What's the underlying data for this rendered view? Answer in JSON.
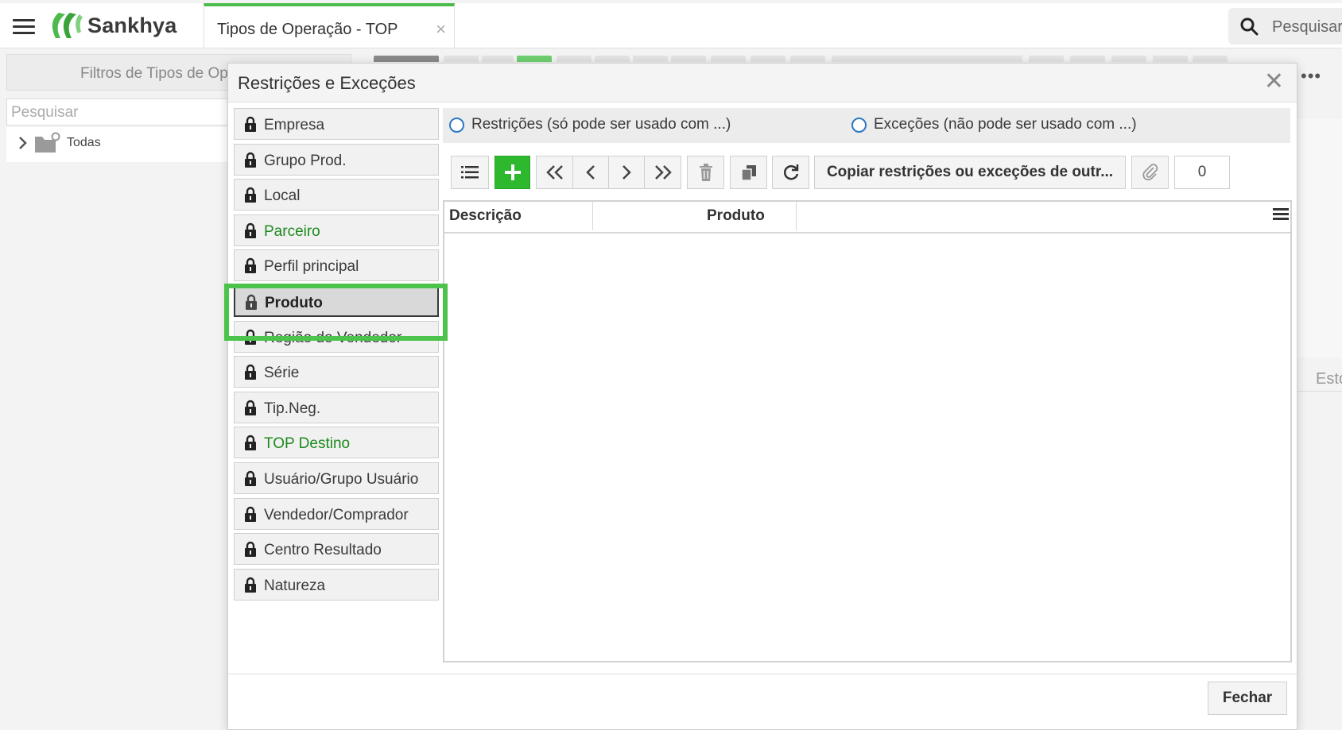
{
  "app": {
    "brand": "Sankhya"
  },
  "tab": {
    "label": "Tipos de Operação - TOP",
    "close": "×"
  },
  "search": {
    "placeholder": "Pesquisar"
  },
  "background": {
    "filters_title": "Filtros de Tipos de Op",
    "search_placeholder": "Pesquisar",
    "tree_root": "Todas",
    "more": "•••",
    "right_tab": "Esto"
  },
  "modal": {
    "title": "Restrições e Exceções",
    "close": "✕",
    "items": [
      {
        "label": "Empresa",
        "state": "normal"
      },
      {
        "label": "Grupo Prod.",
        "state": "normal"
      },
      {
        "label": "Local",
        "state": "normal"
      },
      {
        "label": "Parceiro",
        "state": "green"
      },
      {
        "label": "Perfil principal",
        "state": "normal"
      },
      {
        "label": "Produto",
        "state": "selected"
      },
      {
        "label": "Região do Vendedor",
        "state": "normal"
      },
      {
        "label": "Série",
        "state": "normal"
      },
      {
        "label": "Tip.Neg.",
        "state": "normal"
      },
      {
        "label": "TOP Destino",
        "state": "green"
      },
      {
        "label": "Usuário/Grupo Usuário",
        "state": "normal"
      },
      {
        "label": "Vendedor/Comprador",
        "state": "normal"
      },
      {
        "label": "Centro Resultado",
        "state": "normal"
      },
      {
        "label": "Natureza",
        "state": "normal"
      }
    ],
    "radio_restricoes": "Restrições (só pode ser usado com ...)",
    "radio_excecoes": "Exceções (não pode ser usado com ...)",
    "copy_button": "Copiar restrições ou exceções de outr...",
    "count": "0",
    "columns": [
      "Descrição",
      "Produto"
    ],
    "close_button": "Fechar"
  },
  "colors": {
    "accent_green": "#2eb82e",
    "highlight_green": "#4cc34c",
    "radio_blue": "#2a77c5",
    "green_text": "#1d8a1d"
  }
}
